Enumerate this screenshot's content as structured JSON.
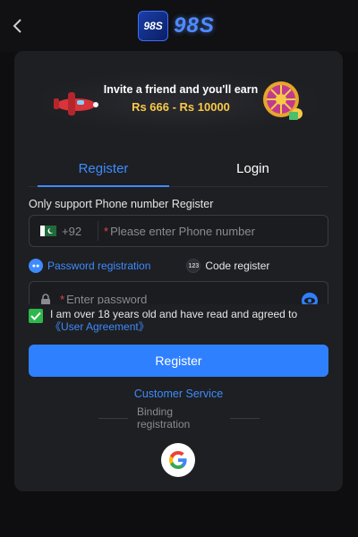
{
  "header": {
    "back_icon": "chevron-left-icon",
    "logo_badge_text": "98S",
    "logo_text": "98S"
  },
  "banner": {
    "line1": "Invite a friend and you'll earn",
    "line2": "Rs 666 - Rs 10000",
    "line2_color": "#f7c948"
  },
  "tabs": [
    {
      "label": "Register",
      "active": true
    },
    {
      "label": "Login",
      "active": false
    }
  ],
  "form": {
    "hint": "Only support Phone number Register",
    "country_code": "+92",
    "phone_placeholder": "Please enter Phone number",
    "password_option": "Password registration",
    "code_option": "Code register",
    "code_icon_text": "123",
    "password_placeholder": "Enter password",
    "agree_text": "I am over 18 years old and have read and agreed to",
    "agreement_link": "《User Agreement》",
    "agreement_checked": true,
    "register_button": "Register"
  },
  "footer": {
    "customer_service": "Customer Service",
    "binding": "Binding registration",
    "google_icon": "google-icon"
  },
  "colors": {
    "accent": "#2f80ff",
    "background": "#0e0e10",
    "card": "#1e1f22",
    "check": "#2db84c"
  }
}
